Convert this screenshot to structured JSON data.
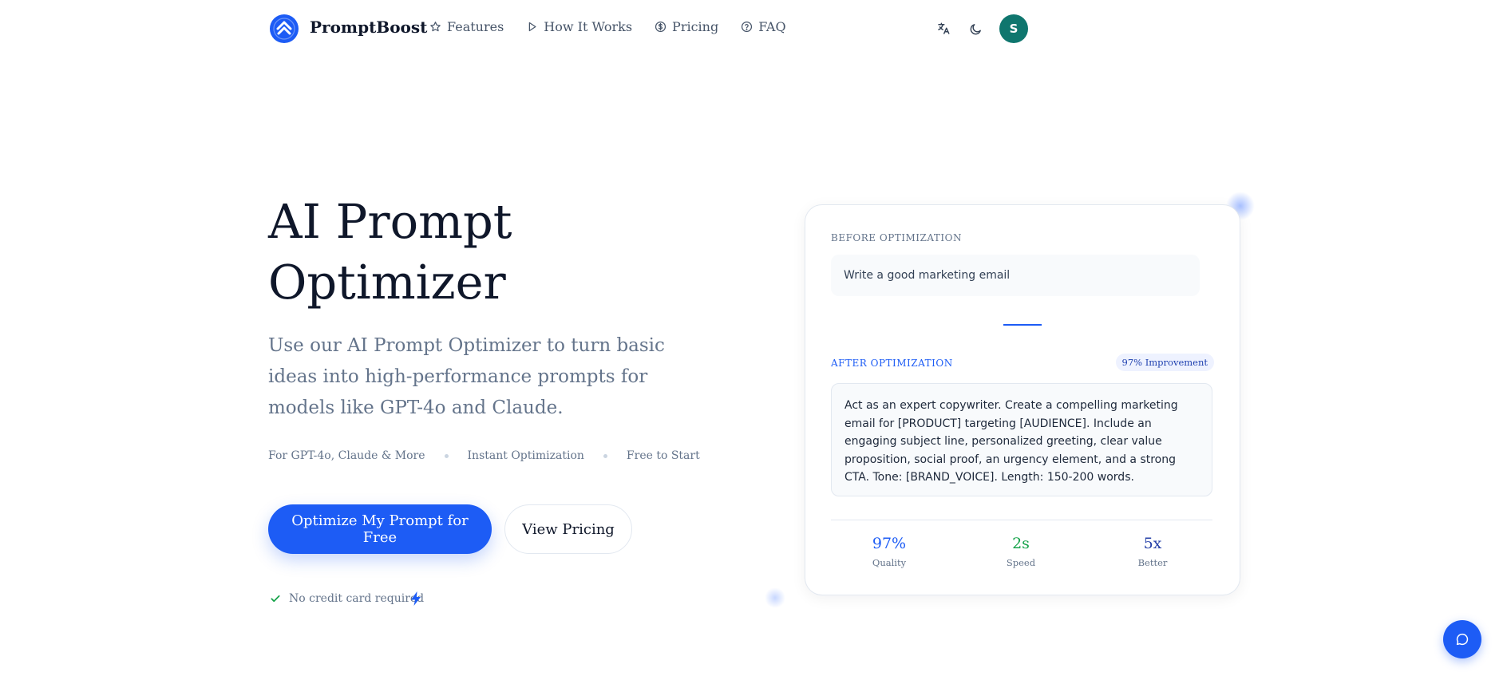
{
  "header": {
    "brand": "PromptBoost",
    "nav": [
      {
        "label": "Features",
        "icon": "star-icon"
      },
      {
        "label": "How It Works",
        "icon": "play-icon"
      },
      {
        "label": "Pricing",
        "icon": "dollar-circle-icon"
      },
      {
        "label": "FAQ",
        "icon": "question-circle-icon"
      }
    ],
    "avatar_initial": "S"
  },
  "hero": {
    "title": "AI Prompt Optimizer",
    "subtitle": "Use our AI Prompt Optimizer to turn basic ideas into high-performance prompts for models like GPT-4o and Claude.",
    "features": [
      "For GPT-4o, Claude & More",
      "Instant Optimization",
      "Free to Start"
    ],
    "primary_cta": "Optimize My Prompt for Free",
    "secondary_cta": "View Pricing",
    "note": "No credit card required"
  },
  "demo_card": {
    "before_label": "BEFORE OPTIMIZATION",
    "before_text": "Write a good marketing email",
    "after_label": "AFTER OPTIMIZATION",
    "badge": "97% Improvement",
    "after_text": "Act as an expert copywriter. Create a compelling marketing email for [PRODUCT] targeting [AUDIENCE]. Include an engaging subject line, personalized greeting, clear value proposition, social proof, an urgency element, and a strong CTA. Tone: [BRAND_VOICE]. Length: 150-200 words.",
    "stats": [
      {
        "value": "97%",
        "label": "Quality"
      },
      {
        "value": "2s",
        "label": "Speed"
      },
      {
        "value": "5x",
        "label": "Better"
      }
    ]
  },
  "colors": {
    "accent": "#1d5cf5",
    "avatar": "#0f766e",
    "success": "#16a34a"
  }
}
